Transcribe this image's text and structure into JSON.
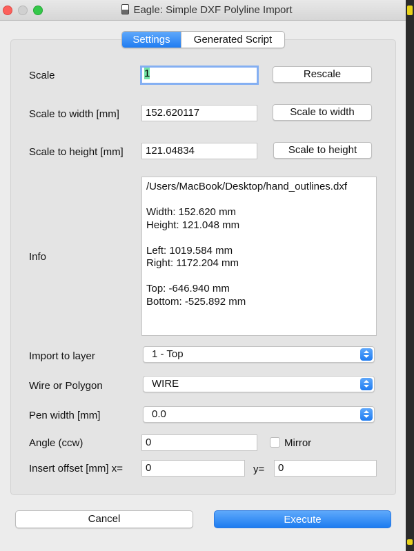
{
  "window": {
    "title": "Eagle: Simple DXF Polyline Import"
  },
  "tabs": [
    {
      "label": "Settings",
      "active": true
    },
    {
      "label": "Generated Script",
      "active": false
    }
  ],
  "scale": {
    "label": "Scale",
    "value": "1",
    "button": "Rescale"
  },
  "scale_to_width": {
    "label": "Scale to width [mm]",
    "value": "152.620117",
    "button": "Scale to width"
  },
  "scale_to_height": {
    "label": "Scale to height [mm]",
    "value": "121.04834",
    "button": "Scale to height"
  },
  "info": {
    "label": "Info",
    "lines": [
      "/Users/MacBook/Desktop/hand_outlines.dxf",
      "",
      "Width: 152.620 mm",
      "Height: 121.048 mm",
      "",
      "Left: 1019.584 mm",
      "Right: 1172.204 mm",
      "",
      "Top: -646.940 mm",
      "Bottom: -525.892 mm"
    ]
  },
  "import_layer": {
    "label": "Import to layer",
    "selected": "1 - Top"
  },
  "wire_or_polygon": {
    "label": "Wire or Polygon",
    "selected": "WIRE"
  },
  "pen_width": {
    "label": "Pen width [mm]",
    "selected": "0.0"
  },
  "angle": {
    "label": "Angle (ccw)",
    "value": "0",
    "mirror_label": "Mirror",
    "mirror_checked": false
  },
  "insert_offset": {
    "label": "Insert offset [mm] x=",
    "x_value": "0",
    "y_label": "y=",
    "y_value": "0"
  },
  "footer": {
    "cancel_label": "Cancel",
    "execute_label": "Execute"
  },
  "colors": {
    "accent": "#1f7cf1",
    "close": "#fc605c",
    "maximize": "#34c84a",
    "selection_highlight": "#75e3a6"
  }
}
